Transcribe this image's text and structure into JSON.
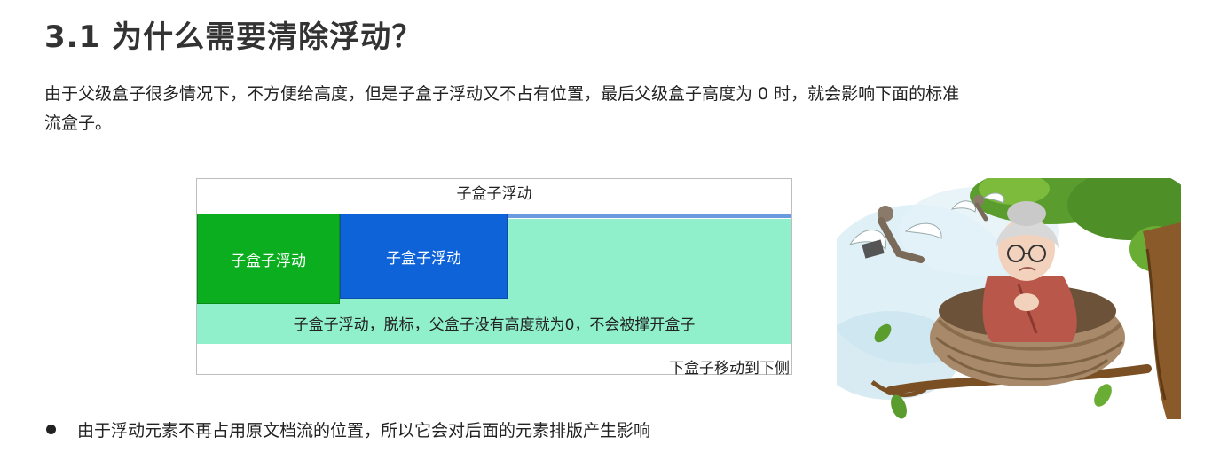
{
  "heading": "3.1 为什么需要清除浮动？",
  "paragraph": "由于父级盒子很多情况下，不方便给高度，但是子盒子浮动又不占有位置，最后父级盒子高度为 0 时，就会影响下面的标准流盒子。",
  "diagram": {
    "parent_label": "子盒子浮动",
    "green_box": "子盒子浮动",
    "blue_box": "子盒子浮动",
    "mint_text": "子盒子浮动，脱标，父盒子没有高度就为0，不会被撑开盒子",
    "bottom_text": "下盒子移动到下侧",
    "colors": {
      "green": "#0aae1f",
      "blue": "#0f63d8",
      "mint": "#90f0cc",
      "line": "#6a9ae0"
    }
  },
  "illustration_icon": "grandma-in-nest-icon",
  "bullet": "由于浮动元素不再占用原文档流的位置，所以它会对后面的元素排版产生影响"
}
